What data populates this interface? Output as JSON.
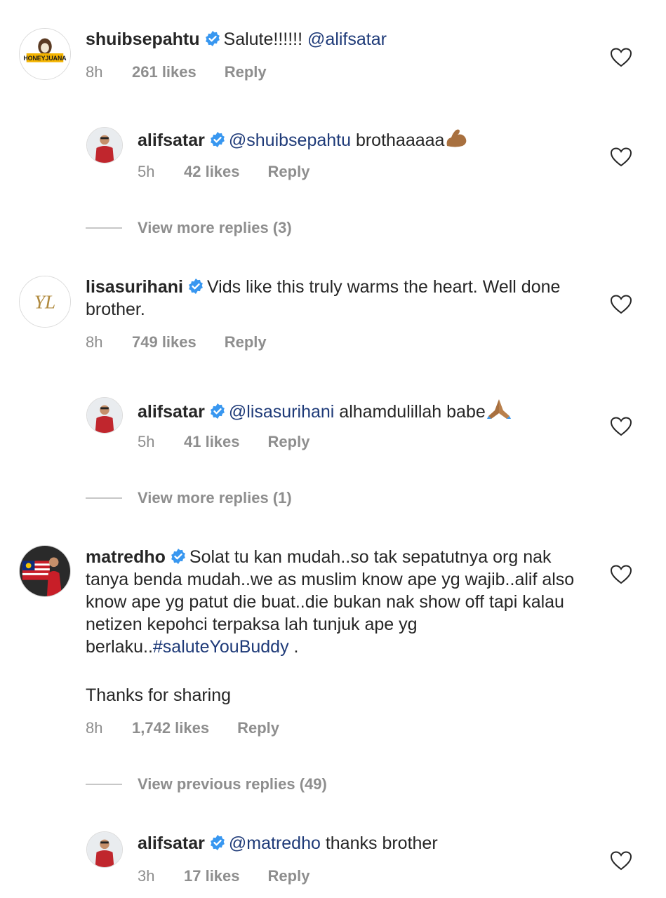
{
  "comments": [
    {
      "username": "shuibsepahtu",
      "mention": "",
      "body": "Salute!!!!!! ",
      "trailing_mention": "@alifsatar",
      "time": "8h",
      "likes": "261 likes",
      "reply": "Reply",
      "avatar_text": "HONEYJUANA"
    },
    {
      "username": "alifsatar",
      "mention": "@shuibsepahtu",
      "body": " brothaaaaa",
      "time": "5h",
      "likes": "42 likes",
      "reply": "Reply",
      "emoji": "flexed-biceps-emoji"
    },
    {
      "view_more": "View more replies (3)"
    },
    {
      "username": "lisasurihani",
      "body": "Vids like this truly warms the heart. Well done brother.",
      "time": "8h",
      "likes": "749 likes",
      "reply": "Reply",
      "avatar_text": "YL"
    },
    {
      "username": "alifsatar",
      "mention": "@lisasurihani",
      "body": " alhamdulillah babe",
      "time": "5h",
      "likes": "41 likes",
      "reply": "Reply",
      "emoji": "folded-hands-emoji"
    },
    {
      "view_more": "View more replies (1)"
    },
    {
      "username": "matredho",
      "body": "Solat tu kan mudah..so tak sepatutnya org nak tanya benda mudah..we as muslim know ape yg wajib..alif also know ape yg patut die buat..die bukan nak show off tapi kalau netizen kepohci terpaksa lah tunjuk ape yg berlaku..",
      "hashtag": "#saluteYouBuddy",
      "body_after": " .",
      "body_line2": "Thanks for sharing",
      "time": "8h",
      "likes": "1,742 likes",
      "reply": "Reply"
    },
    {
      "view_more": "View previous replies (49)"
    },
    {
      "username": "alifsatar",
      "mention": "@matredho",
      "body": " thanks brother",
      "time": "3h",
      "likes": "17 likes",
      "reply": "Reply"
    }
  ],
  "colors": {
    "text": "#262626",
    "meta": "#8e8e8e",
    "mention": "#1e3a78",
    "verified": "#3897f0"
  }
}
